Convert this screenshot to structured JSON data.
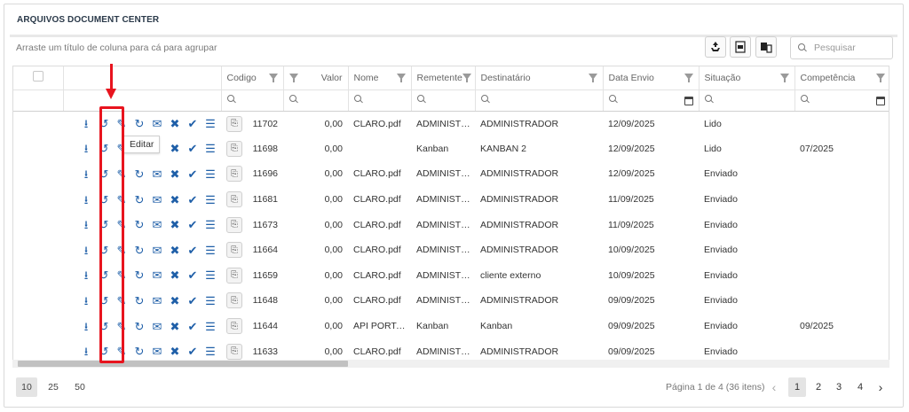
{
  "panel": {
    "title": "ARQUIVOS DOCUMENT CENTER"
  },
  "toolbar": {
    "group_hint": "Arraste um título de coluna para cá para agrupar",
    "search_placeholder": "Pesquisar",
    "buttons": [
      "recycle-icon",
      "export-excel-icon",
      "column-chooser-icon"
    ]
  },
  "columns": [
    "",
    "",
    "Codigo",
    "Valor",
    "Nome",
    "Remetente",
    "Destinatário",
    "Data Envio",
    "Situação",
    "Competência"
  ],
  "rows": [
    {
      "codigo": "11702",
      "valor": "0,00",
      "nome": "CLARO.pdf",
      "remetente": "ADMINISTR...",
      "destinatario": "ADMINISTRADOR",
      "data_envio": "12/09/2025",
      "situacao": "Lido",
      "competencia": ""
    },
    {
      "codigo": "11698",
      "valor": "0,00",
      "nome": "",
      "remetente": "Kanban",
      "destinatario": "KANBAN 2",
      "data_envio": "12/09/2025",
      "situacao": "Lido",
      "competencia": "07/2025"
    },
    {
      "codigo": "11696",
      "valor": "0,00",
      "nome": "CLARO.pdf",
      "remetente": "ADMINISTR...",
      "destinatario": "ADMINISTRADOR",
      "data_envio": "12/09/2025",
      "situacao": "Enviado",
      "competencia": ""
    },
    {
      "codigo": "11681",
      "valor": "0,00",
      "nome": "CLARO.pdf",
      "remetente": "ADMINISTR...",
      "destinatario": "ADMINISTRADOR",
      "data_envio": "11/09/2025",
      "situacao": "Enviado",
      "competencia": ""
    },
    {
      "codigo": "11673",
      "valor": "0,00",
      "nome": "CLARO.pdf",
      "remetente": "ADMINISTR...",
      "destinatario": "ADMINISTRADOR",
      "data_envio": "11/09/2025",
      "situacao": "Enviado",
      "competencia": ""
    },
    {
      "codigo": "11664",
      "valor": "0,00",
      "nome": "CLARO.pdf",
      "remetente": "ADMINISTR...",
      "destinatario": "ADMINISTRADOR",
      "data_envio": "10/09/2025",
      "situacao": "Enviado",
      "competencia": ""
    },
    {
      "codigo": "11659",
      "valor": "0,00",
      "nome": "CLARO.pdf",
      "remetente": "ADMINISTR...",
      "destinatario": "cliente externo",
      "data_envio": "10/09/2025",
      "situacao": "Enviado",
      "competencia": ""
    },
    {
      "codigo": "11648",
      "valor": "0,00",
      "nome": "CLARO.pdf",
      "remetente": "ADMINISTR...",
      "destinatario": "ADMINISTRADOR",
      "data_envio": "09/09/2025",
      "situacao": "Enviado",
      "competencia": ""
    },
    {
      "codigo": "11644",
      "valor": "0,00",
      "nome": "API PORTAL...",
      "remetente": "Kanban",
      "destinatario": "Kanban",
      "data_envio": "09/09/2025",
      "situacao": "Enviado",
      "competencia": "09/2025"
    },
    {
      "codigo": "11633",
      "valor": "0,00",
      "nome": "CLARO.pdf",
      "remetente": "ADMINISTR...",
      "destinatario": "ADMINISTRADOR",
      "data_envio": "09/09/2025",
      "situacao": "Enviado",
      "competencia": ""
    }
  ],
  "row_actions": [
    "download-icon",
    "history-icon",
    "edit-icon",
    "resend-icon",
    "open-envelope-icon",
    "delete-icon",
    "approve-icon",
    "details-icon"
  ],
  "tooltip": {
    "text": "Editar"
  },
  "pager": {
    "sizes": [
      "10",
      "25",
      "50"
    ],
    "active_size": "10",
    "info": "Página 1 de 4 (36 itens)",
    "pages": [
      "1",
      "2",
      "3",
      "4"
    ],
    "active_page": "1"
  },
  "colors": {
    "highlight": "#e8141e",
    "action_icons": "#1f5fa8"
  }
}
